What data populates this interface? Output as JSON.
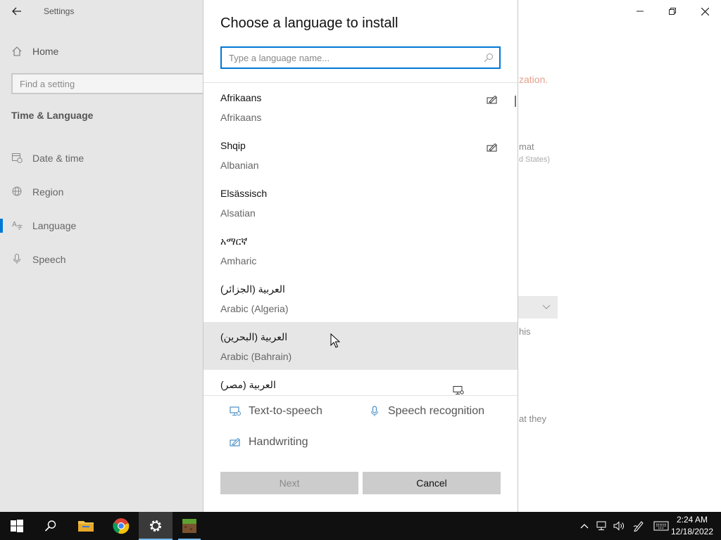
{
  "window": {
    "title": "Settings",
    "controls": {
      "minimize": "minimize",
      "maximize": "restore",
      "close": "close"
    }
  },
  "sidebar": {
    "home_label": "Home",
    "search_placeholder": "Find a setting",
    "section_title": "Time & Language",
    "items": [
      {
        "label": "Date & time",
        "icon": "calendar-clock-icon"
      },
      {
        "label": "Region",
        "icon": "globe-icon"
      },
      {
        "label": "Language",
        "icon": "language-icon",
        "active": true
      },
      {
        "label": "Speech",
        "icon": "microphone-icon"
      }
    ]
  },
  "background": {
    "snippet1": "zation.",
    "snippet2": "mat",
    "snippet3": "d States)",
    "snippet4": "his",
    "snippet5": "at they"
  },
  "dialog": {
    "title": "Choose a language to install",
    "search_placeholder": "Type a language name...",
    "languages": [
      {
        "native": "Afrikaans",
        "english": "Afrikaans",
        "feature_icon": "handwriting-icon"
      },
      {
        "native": "Shqip",
        "english": "Albanian",
        "feature_icon": "handwriting-icon"
      },
      {
        "native": "Elsässisch",
        "english": "Alsatian"
      },
      {
        "native": "አማርኛ",
        "english": "Amharic"
      },
      {
        "native": "العربية (الجزائر)",
        "english": "Arabic (Algeria)"
      },
      {
        "native": "العربية (البحرين)",
        "english": "Arabic (Bahrain)",
        "hover": true
      },
      {
        "native": "العربية (مصر)",
        "english": "",
        "feature_icon": "text-to-speech-icon"
      }
    ],
    "features": {
      "tts": "Text-to-speech",
      "speech": "Speech recognition",
      "handwriting": "Handwriting"
    },
    "buttons": {
      "next": "Next",
      "cancel": "Cancel"
    }
  },
  "taskbar": {
    "time": "2:24 AM",
    "date": "12/18/2022"
  },
  "colors": {
    "accent": "#0078d7",
    "taskbar": "#101010",
    "sidebar": "#e6e6e6"
  }
}
